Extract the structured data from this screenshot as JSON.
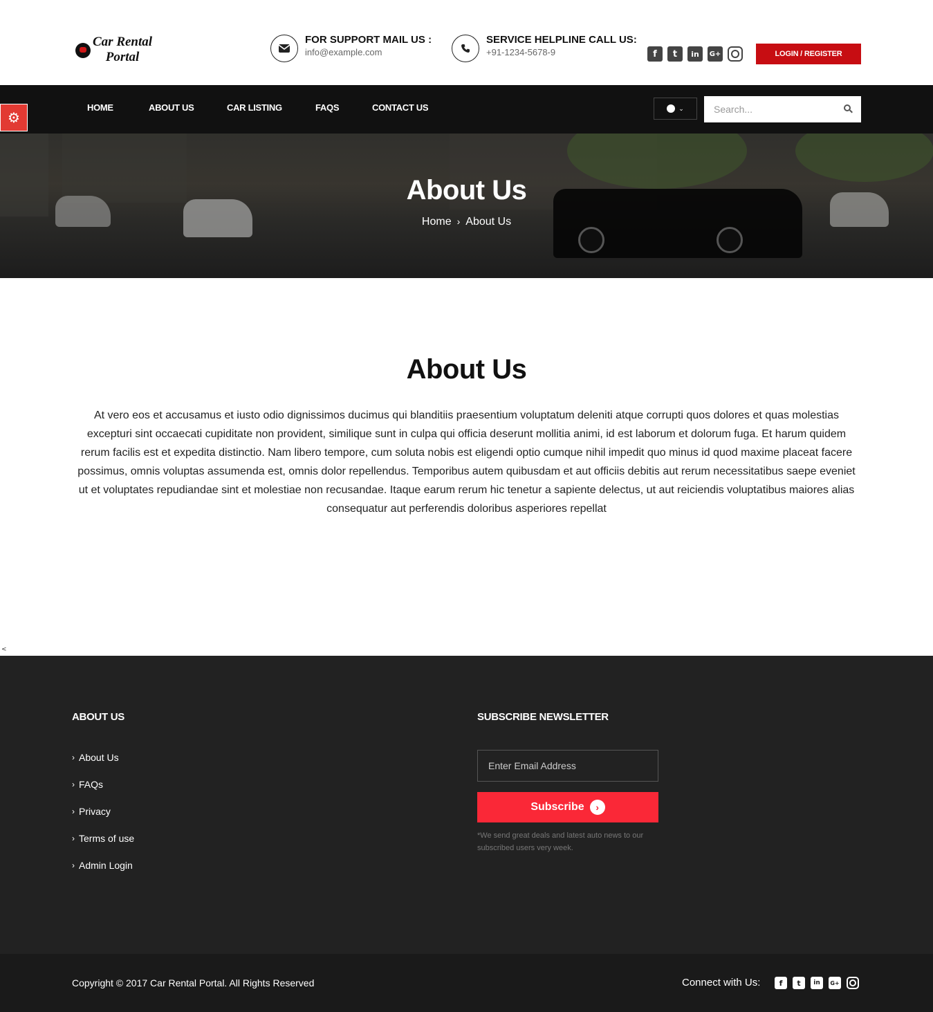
{
  "stray_marks": {
    "top": "<",
    "bottom": "<"
  },
  "header": {
    "logo_line1": "Car Rental",
    "logo_line2": "Portal",
    "support": {
      "title": "FOR SUPPORT MAIL US :",
      "value": "info@example.com",
      "icon": "envelope-icon"
    },
    "helpline": {
      "title": "SERVICE HELPLINE CALL US:",
      "value": "+91-1234-5678-9",
      "icon": "phone-icon"
    },
    "social": [
      {
        "name": "facebook-icon",
        "glyph": "f"
      },
      {
        "name": "twitter-icon",
        "glyph": "t"
      },
      {
        "name": "linkedin-icon",
        "glyph": "in"
      },
      {
        "name": "google-plus-icon",
        "glyph": "G+"
      },
      {
        "name": "instagram-icon",
        "glyph": ""
      }
    ],
    "login_label": "LOGIN / REGISTER",
    "accent_color": "#c70d12"
  },
  "nav": {
    "items": [
      "HOME",
      "ABOUT US",
      "CAR LISTING",
      "FAQS",
      "CONTACT US"
    ],
    "search_placeholder": "Search...",
    "user_icon": "user-circle-icon",
    "chevron": "⌄"
  },
  "settings_icon": "gear-icon",
  "banner": {
    "title": "About Us",
    "breadcrumb": [
      "Home",
      "About Us"
    ]
  },
  "main": {
    "title": "About Us",
    "body": "At vero eos et accusamus et iusto odio dignissimos ducimus qui blanditiis praesentium voluptatum deleniti atque corrupti quos dolores et quas molestias excepturi sint occaecati cupiditate non provident, similique sunt in culpa qui officia deserunt mollitia animi, id est laborum et dolorum fuga. Et harum quidem rerum facilis est et expedita distinctio. Nam libero tempore, cum soluta nobis est eligendi optio cumque nihil impedit quo minus id quod maxime placeat facere possimus, omnis voluptas assumenda est, omnis dolor repellendus. Temporibus autem quibusdam et aut officiis debitis aut rerum necessitatibus saepe eveniet ut et voluptates repudiandae sint et molestiae non recusandae. Itaque earum rerum hic tenetur a sapiente delectus, ut aut reiciendis voluptatibus maiores alias consequatur aut perferendis doloribus asperiores repellat"
  },
  "footer": {
    "about_heading": "ABOUT US",
    "links": [
      "About Us",
      "FAQs",
      "Privacy",
      "Terms of use",
      "Admin Login"
    ],
    "newsletter_heading": "SUBSCRIBE NEWSLETTER",
    "email_placeholder": "Enter Email Address",
    "subscribe_label": "Subscribe",
    "note": "*We send great deals and latest auto news to our subscribed users very week.",
    "subscribe_color": "#fa2837"
  },
  "bottom": {
    "copyright": "Copyright © 2017 Car Rental Portal. All Rights Reserved",
    "connect_label": "Connect with Us:",
    "social": [
      {
        "name": "facebook-icon",
        "glyph": "f"
      },
      {
        "name": "twitter-icon",
        "glyph": "t"
      },
      {
        "name": "linkedin-icon",
        "glyph": "in"
      },
      {
        "name": "google-plus-icon",
        "glyph": "G+"
      },
      {
        "name": "instagram-icon",
        "glyph": ""
      }
    ]
  }
}
